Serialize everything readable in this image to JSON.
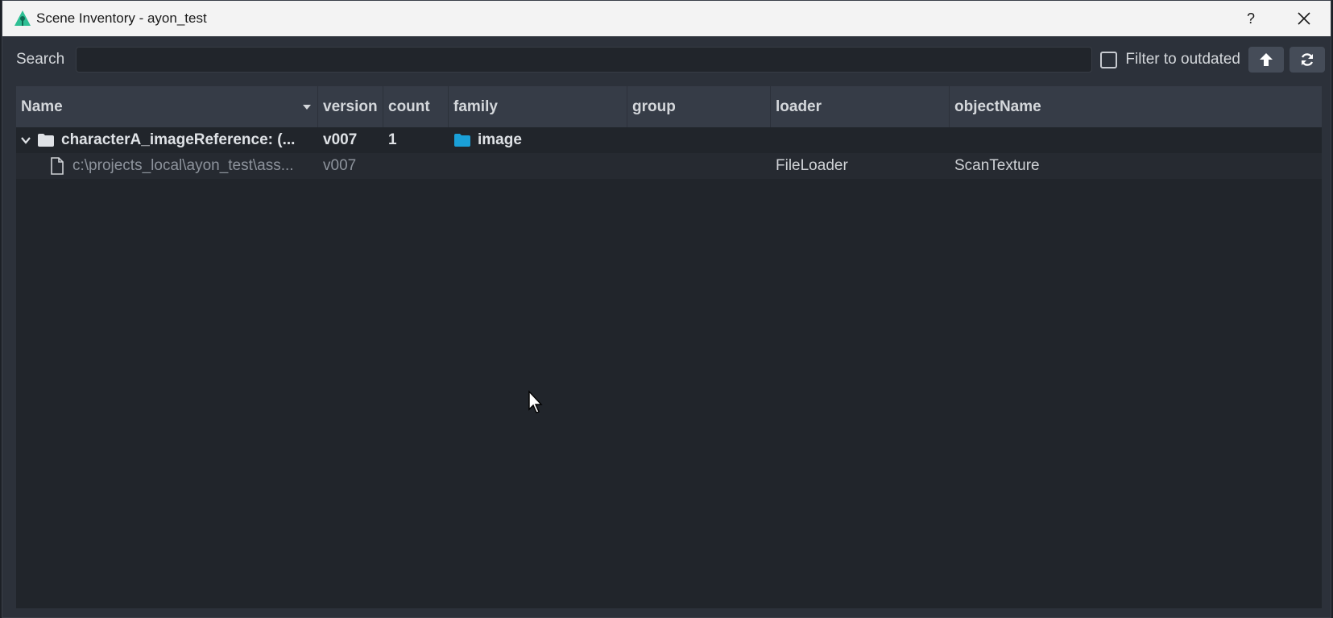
{
  "window": {
    "title": "Scene Inventory - ayon_test",
    "help_label": "?",
    "close_label": "✕"
  },
  "toolbar": {
    "search_label": "Search",
    "search_value": "",
    "filter_label": "Filter to outdated",
    "filter_checked": false
  },
  "columns": [
    "Name",
    "version",
    "count",
    "family",
    "group",
    "loader",
    "objectName"
  ],
  "rows": [
    {
      "name": "characterA_imageReference: (...",
      "version": "v007",
      "count": "1",
      "family": "image",
      "group": "",
      "loader": "",
      "objectName": ""
    },
    {
      "name": "c:\\projects_local\\ayon_test\\ass...",
      "version": "v007",
      "count": "",
      "family": "",
      "group": "",
      "loader": "FileLoader",
      "objectName": "ScanTexture"
    }
  ],
  "colors": {
    "accent": "#2ebf94",
    "family_icon": "#1aa0d8"
  }
}
